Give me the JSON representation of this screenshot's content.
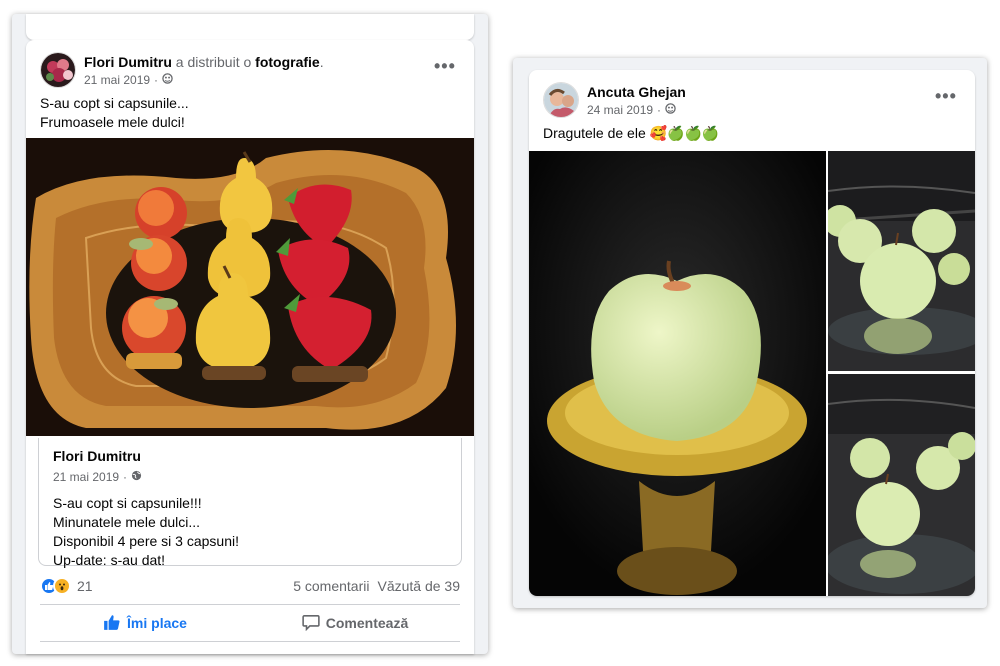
{
  "left_post": {
    "author": "Flori Dumitru",
    "action_text": "a distribuit o",
    "object": "fotografie",
    "period": ".",
    "date": "21 mai 2019",
    "separator": "·",
    "audience_icon": "friends-icon",
    "more_label": "•••",
    "text_line1": "S-au copt si capsunile...",
    "text_line2": "Frumoasele mele dulci!",
    "photo_description_icon": "fruit-desserts-photo",
    "shared": {
      "author": "Flori Dumitru",
      "date": "21 mai 2019",
      "separator": "·",
      "audience_icon": "globe-icon",
      "lines": [
        "S-au copt si capsunile!!!",
        "Minunatele mele dulci...",
        "Disponibil 4 pere si 3 capsuni!",
        "Up-date: s-au dat!"
      ]
    },
    "reactions_count": "21",
    "comments": "5 comentarii",
    "views": "Văzută de 39",
    "like_label": "Îmi place",
    "comment_label": "Comentează"
  },
  "right_post": {
    "author": "Ancuta Ghejan",
    "date": "24 mai 2019",
    "separator": "·",
    "audience_icon": "friends-icon",
    "more_label": "•••",
    "text": "Dragutele de ele 🥰🍏🍏🍏"
  },
  "colors": {
    "facebook_blue": "#1877f2",
    "secondary_text": "#65676b",
    "border": "#ced0d4",
    "background": "#f0f2f5"
  }
}
